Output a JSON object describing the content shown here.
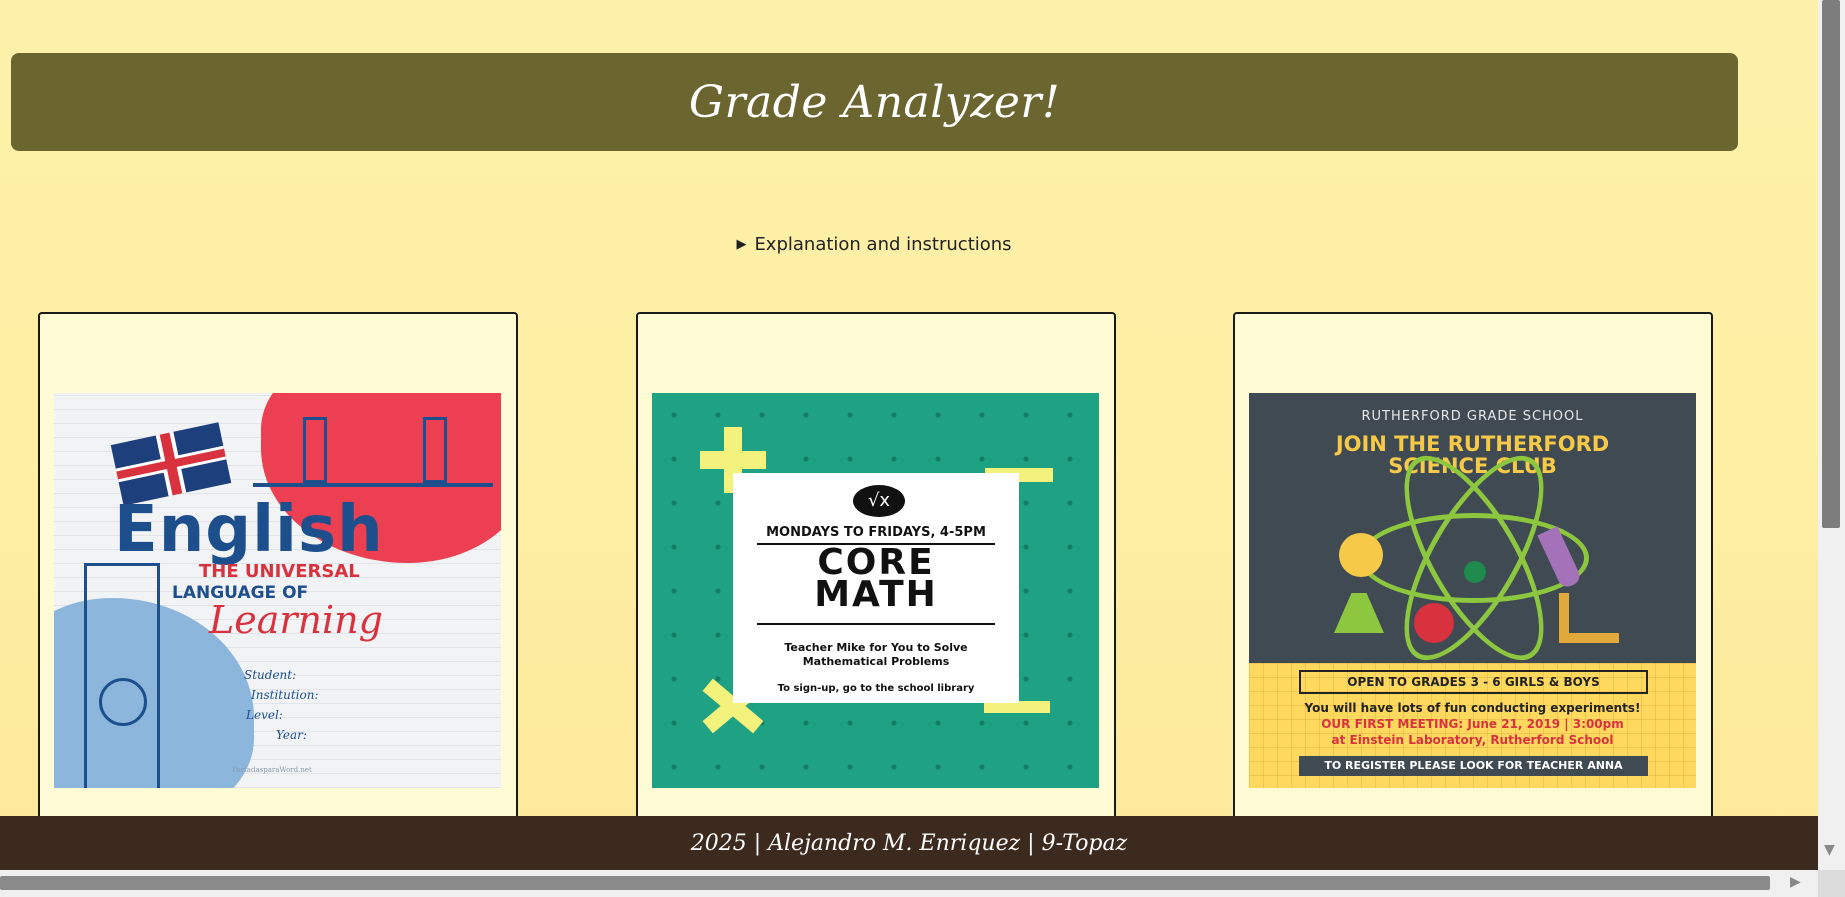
{
  "header": {
    "title": "Grade Analyzer!"
  },
  "instructions": {
    "summary": "Explanation and instructions",
    "toggle_icon": "triangle-right-icon"
  },
  "cards": {
    "english": {
      "title": "English",
      "subtitle1": "THE UNIVERSAL",
      "subtitle2": "LANGUAGE OF",
      "subtitle3": "Learning",
      "fields": [
        "Student:",
        "Institution:",
        "Level:",
        "Year:"
      ],
      "credit": "PortadasparaWord.net"
    },
    "math": {
      "logo": "√x",
      "schedule": "MONDAYS TO FRIDAYS, 4-5PM",
      "title_line1": "CORE",
      "title_line2": "MATH",
      "description": "Teacher Mike for You to Solve Mathematical Problems",
      "signup": "To sign-up, go to the school library"
    },
    "science": {
      "school": "RUTHERFORD GRADE SCHOOL",
      "title_line1": "JOIN THE RUTHERFORD",
      "title_line2": "SCIENCE CLUB",
      "grades": "OPEN TO GRADES 3 - 6 GIRLS & BOYS",
      "fun": "You will have lots of fun conducting experiments!",
      "meeting_line1": "OUR FIRST MEETING: June 21, 2019 | 3:00pm",
      "meeting_line2": "at Einstein Laboratory, Rutherford School",
      "register": "TO REGISTER PLEASE LOOK FOR TEACHER ANNA"
    }
  },
  "footer": {
    "text": "2025 | Alejandro M. Enriquez | 9-Topaz"
  },
  "colors": {
    "header_bg": "#6b6530",
    "footer_bg": "#3d2a1e",
    "page_bg": "#fdf0a9",
    "card_bg": "#fffcd5"
  }
}
